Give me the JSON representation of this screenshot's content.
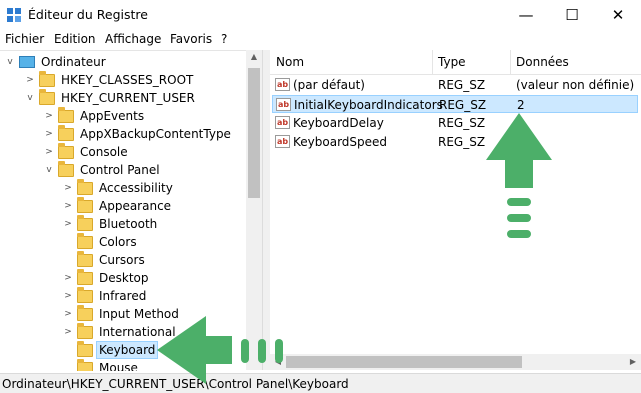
{
  "window": {
    "title": "Éditeur du Registre",
    "controls": {
      "minimize": "—",
      "maximize": "☐",
      "close": "✕"
    }
  },
  "menu": [
    "Fichier",
    "Edition",
    "Affichage",
    "Favoris",
    "?"
  ],
  "tree": {
    "root": "Ordinateur",
    "items": [
      {
        "label": "HKEY_CLASSES_ROOT",
        "expander": ">"
      },
      {
        "label": "HKEY_CURRENT_USER",
        "expander": "v"
      },
      {
        "label": "AppEvents",
        "expander": ">"
      },
      {
        "label": "AppXBackupContentType",
        "expander": ">"
      },
      {
        "label": "Console",
        "expander": ">"
      },
      {
        "label": "Control Panel",
        "expander": "v"
      },
      {
        "label": "Accessibility",
        "expander": ">"
      },
      {
        "label": "Appearance",
        "expander": ">"
      },
      {
        "label": "Bluetooth",
        "expander": ">"
      },
      {
        "label": "Colors",
        "expander": ""
      },
      {
        "label": "Cursors",
        "expander": ""
      },
      {
        "label": "Desktop",
        "expander": ">"
      },
      {
        "label": "Infrared",
        "expander": ">"
      },
      {
        "label": "Input Method",
        "expander": ">"
      },
      {
        "label": "International",
        "expander": ">"
      },
      {
        "label": "Keyboard",
        "expander": ""
      },
      {
        "label": "Mouse",
        "expander": ""
      }
    ]
  },
  "list": {
    "columns": [
      "Nom",
      "Type",
      "Données"
    ],
    "rows": [
      {
        "name": "(par défaut)",
        "type": "REG_SZ",
        "data": "(valeur non définie)"
      },
      {
        "name": "InitialKeyboardIndicators",
        "type": "REG_SZ",
        "data": "2"
      },
      {
        "name": "KeyboardDelay",
        "type": "REG_SZ",
        "data": ""
      },
      {
        "name": "KeyboardSpeed",
        "type": "REG_SZ",
        "data": ""
      }
    ]
  },
  "status": {
    "path": "Ordinateur\\HKEY_CURRENT_USER\\Control Panel\\Keyboard"
  },
  "colors": {
    "selection": "#cce8ff",
    "arrow": "#4caf69",
    "folder": "#f7d05c"
  }
}
